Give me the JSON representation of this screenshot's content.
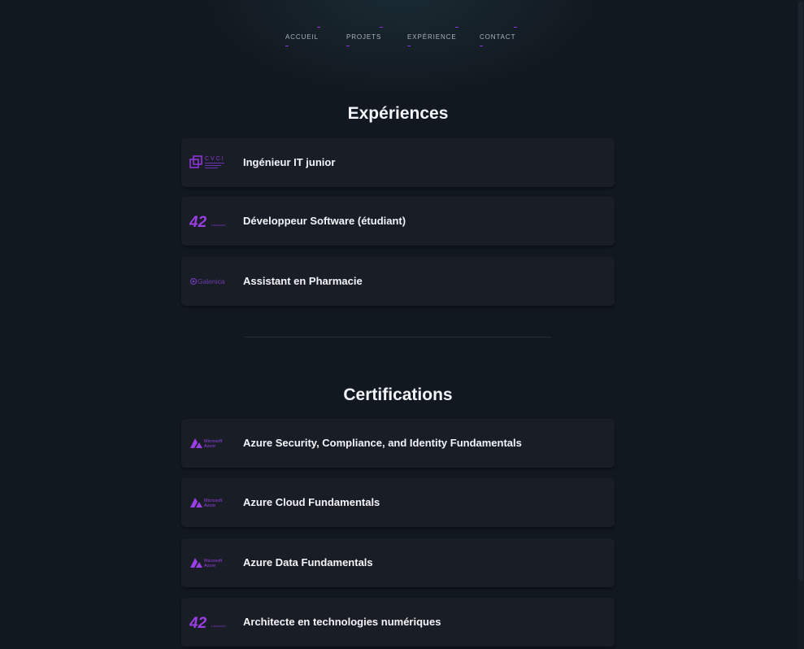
{
  "nav": {
    "items": [
      {
        "label": "ACCUEIL"
      },
      {
        "label": "PROJETS"
      },
      {
        "label": "EXPÉRIENCE"
      },
      {
        "label": "CONTACT"
      }
    ]
  },
  "experiences": {
    "title": "Expériences",
    "items": [
      {
        "title": "Ingénieur IT junior",
        "logo": "cvci-logo",
        "logo_text": "CVCI"
      },
      {
        "title": "Développeur Software (étudiant)",
        "logo": "42-lausanne-logo",
        "logo_text": "42",
        "logo_sub": "Lausanne"
      },
      {
        "title": "Assistant en Pharmacie",
        "logo": "galenica-logo",
        "logo_text": "Galenica"
      }
    ]
  },
  "certifications": {
    "title": "Certifications",
    "items": [
      {
        "title": "Azure Security, Compliance, and Identity Fundamentals",
        "logo": "microsoft-azure-logo",
        "logo_line1": "Microsoft",
        "logo_line2": "Azure"
      },
      {
        "title": "Azure Cloud Fundamentals",
        "logo": "microsoft-azure-logo",
        "logo_line1": "Microsoft",
        "logo_line2": "Azure"
      },
      {
        "title": "Azure Data Fundamentals",
        "logo": "microsoft-azure-logo",
        "logo_line1": "Microsoft",
        "logo_line2": "Azure"
      },
      {
        "title": "Architecte en technologies numériques",
        "logo": "42-lausanne-logo",
        "logo_text": "42",
        "logo_sub": "Lausanne"
      }
    ]
  },
  "colors": {
    "background": "#121820",
    "card": "#191d25",
    "accent": "#8d35d7",
    "text": "#f3f5f8",
    "nav_text": "#aab2bf"
  }
}
